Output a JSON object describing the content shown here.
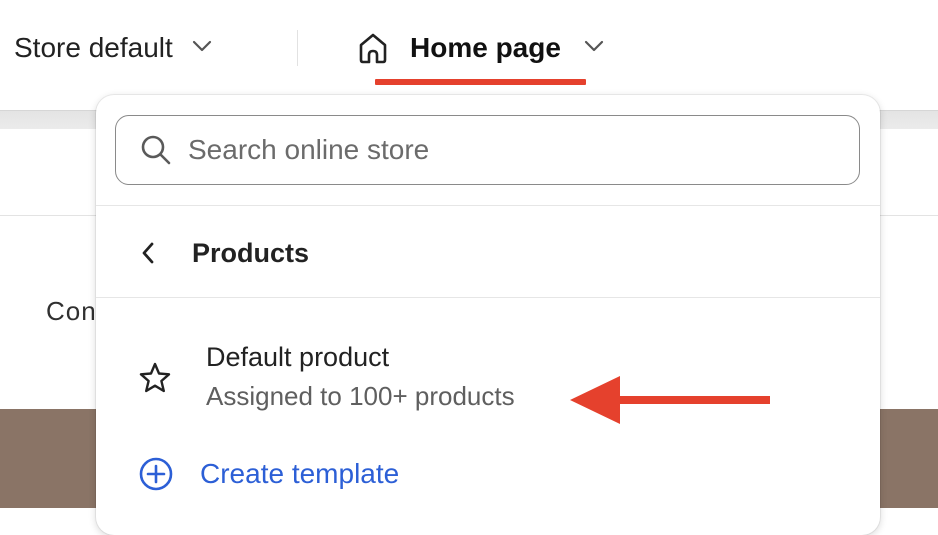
{
  "topbar": {
    "store_selector": {
      "label": "Store default",
      "icon": "chevron-down-icon"
    },
    "page_selector": {
      "label": "Home page",
      "icon": "home-icon",
      "chevron": "chevron-down-icon"
    }
  },
  "background": {
    "partial_text": "Con"
  },
  "dropdown": {
    "search": {
      "placeholder": "Search online store",
      "value": "",
      "icon": "search-icon"
    },
    "back": {
      "label": "Products",
      "icon": "chevron-left-icon"
    },
    "templates": [
      {
        "name": "Default product",
        "subtitle": "Assigned to 100+ products",
        "icon": "star-icon"
      }
    ],
    "create": {
      "label": "Create template",
      "icon": "plus-circle-icon"
    }
  },
  "annotations": {
    "underline_color": "#e5412d",
    "arrow_color": "#e5412d"
  },
  "colors": {
    "link": "#2c5fd6",
    "accent_red": "#e5412d"
  }
}
